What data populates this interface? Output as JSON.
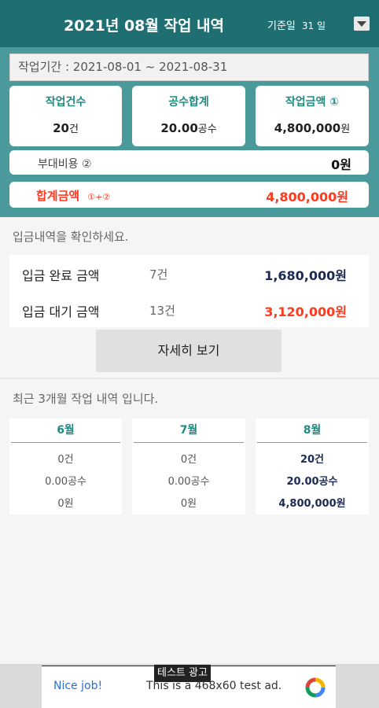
{
  "header": {
    "title": "2021년 08월 작업 내역",
    "base_day_label": "기준일",
    "base_day_value": "31 일"
  },
  "summary": {
    "period": "작업기간 : 2021-08-01 ~ 2021-08-31",
    "cards": [
      {
        "title": "작업건수",
        "value": "20",
        "unit": "건"
      },
      {
        "title": "공수합계",
        "value": "20.00",
        "unit": "공수"
      },
      {
        "title": "작업금액 ①",
        "value": "4,800,000",
        "unit": "원"
      }
    ],
    "extra_cost": {
      "label": "부대비용 ②",
      "value": "0원"
    },
    "total": {
      "label": "합계금액",
      "sub": "①+②",
      "value": "4,800,000원"
    }
  },
  "deposit": {
    "hint": "입금내역을 확인하세요.",
    "rows": [
      {
        "label": "입금 완료 금액",
        "count": "7건",
        "amount": "1,680,000원"
      },
      {
        "label": "입금 대기 금액",
        "count": "13건",
        "amount": "3,120,000원"
      }
    ],
    "detail_button": "자세히 보기"
  },
  "recent": {
    "hint": "최근 3개월 작업 내역 입니다.",
    "months": [
      {
        "month": "6월",
        "count": "0건",
        "manday": "0.00공수",
        "amount": "0원"
      },
      {
        "month": "7월",
        "count": "0건",
        "manday": "0.00공수",
        "amount": "0원"
      },
      {
        "month": "8월",
        "count": "20건",
        "manday": "20.00공수",
        "amount": "4,800,000원"
      }
    ]
  },
  "ad": {
    "tag": "테스트 광고",
    "nice": "Nice job!",
    "text": "This is a 468x60 test ad."
  },
  "colors": {
    "header": "#1f6e72",
    "summary_bg": "#4a9a9c",
    "accent_teal": "#1f8a80",
    "accent_red": "#ff3b1f",
    "navy": "#1a2a55"
  }
}
